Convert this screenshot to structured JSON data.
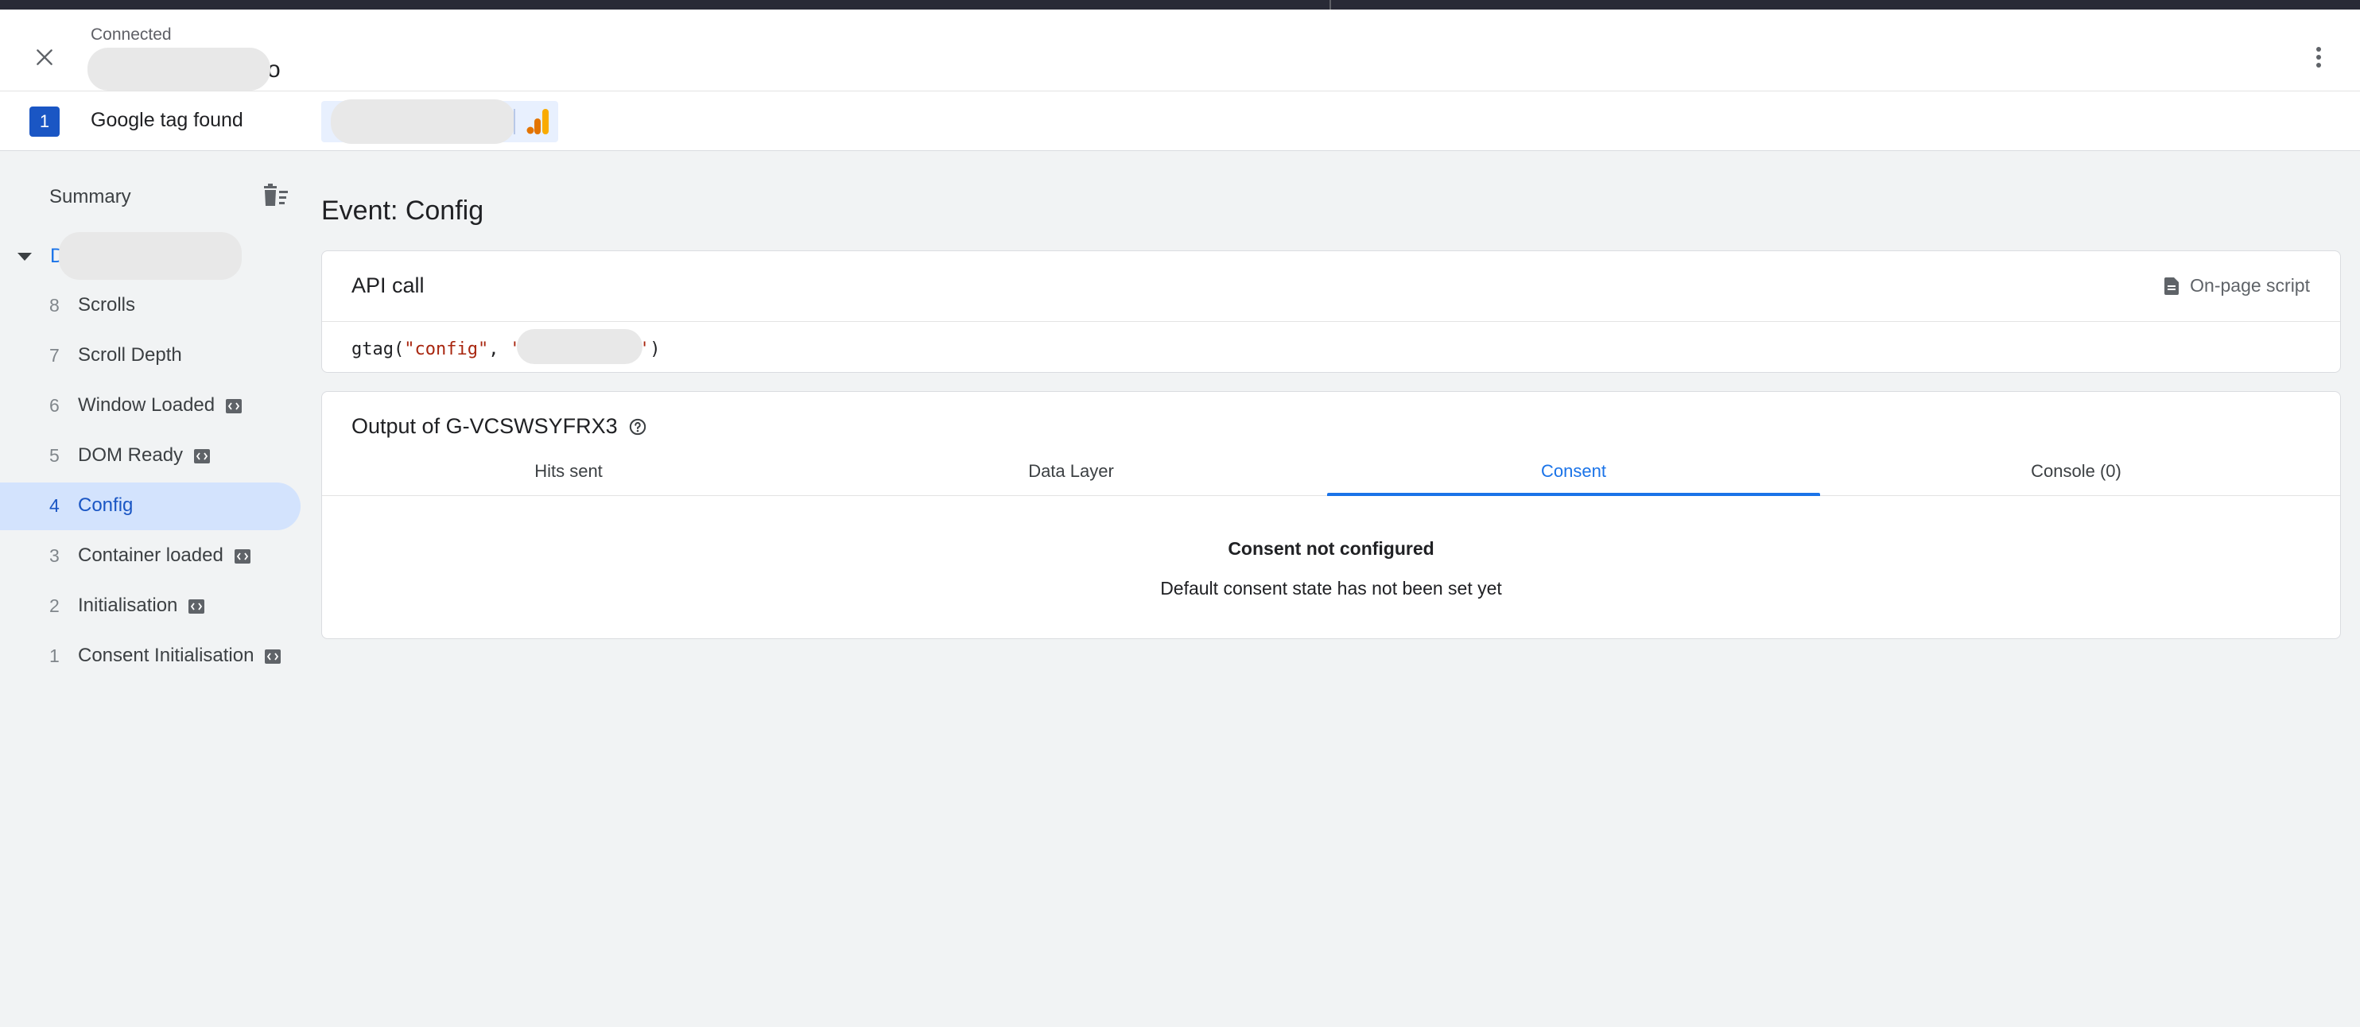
{
  "header": {
    "status_label": "Connected",
    "domain_suffix": "o",
    "close_icon": "close-icon",
    "more_icon": "more-vert-icon"
  },
  "tagbar": {
    "count": "1",
    "label": "Google tag found",
    "chip_icon": "google-analytics-icon"
  },
  "sidebar": {
    "summary_label": "Summary",
    "clear_icon": "delete-sweep-icon",
    "page_letter": "D",
    "events": [
      {
        "num": "8",
        "name": "Scrolls",
        "has_code_icon": false,
        "active": false
      },
      {
        "num": "7",
        "name": "Scroll Depth",
        "has_code_icon": false,
        "active": false
      },
      {
        "num": "6",
        "name": "Window Loaded",
        "has_code_icon": true,
        "active": false
      },
      {
        "num": "5",
        "name": "DOM Ready",
        "has_code_icon": true,
        "active": false
      },
      {
        "num": "4",
        "name": "Config",
        "has_code_icon": false,
        "active": true
      },
      {
        "num": "3",
        "name": "Container loaded",
        "has_code_icon": true,
        "active": false
      },
      {
        "num": "2",
        "name": "Initialisation",
        "has_code_icon": true,
        "active": false
      },
      {
        "num": "1",
        "name": "Consent Initialisation",
        "has_code_icon": true,
        "active": false
      }
    ]
  },
  "main": {
    "title": "Event: Config",
    "api_card": {
      "title": "API call",
      "source_label": "On-page script",
      "code_fn": "gtag(",
      "code_arg1": "\"config\"",
      "code_sep": ", ",
      "code_open_quote": "'",
      "code_close_quote": "'",
      "code_end": ")"
    },
    "output_card": {
      "title": "Output of G-VCSWSYFRX3",
      "help_icon": "help-circle-icon",
      "tabs": [
        {
          "label": "Hits sent",
          "active": false
        },
        {
          "label": "Data Layer",
          "active": false
        },
        {
          "label": "Consent",
          "active": true
        },
        {
          "label": "Console (0)",
          "active": false
        }
      ],
      "consent_heading": "Consent not configured",
      "consent_message": "Default consent state has not been set yet"
    }
  },
  "colors": {
    "accent": "#1a73e8",
    "active_bg": "#d3e3fd",
    "page_bg": "#f1f3f4",
    "topbar": "#292a36"
  }
}
